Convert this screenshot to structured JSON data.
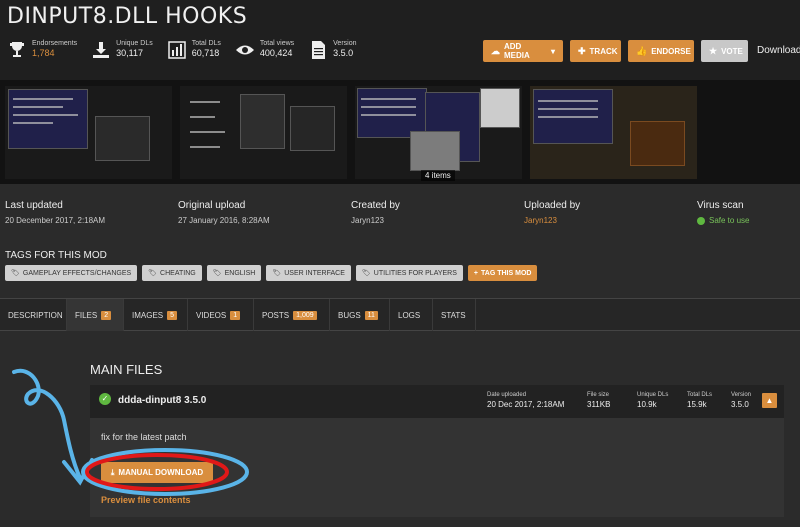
{
  "mod": {
    "title": "DINPUT8.DLL HOOKS"
  },
  "stats": [
    {
      "label": "Endorsements",
      "value": "1,784",
      "icon": "trophy-icon"
    },
    {
      "label": "Unique DLs",
      "value": "30,117",
      "icon": "download-icon"
    },
    {
      "label": "Total DLs",
      "value": "60,718",
      "icon": "bar-chart-icon"
    },
    {
      "label": "Total views",
      "value": "400,424",
      "icon": "eye-icon"
    },
    {
      "label": "Version",
      "value": "3.5.0",
      "icon": "document-icon"
    }
  ],
  "actions": {
    "add_media": "ADD MEDIA",
    "track": "TRACK",
    "endorse": "ENDORSE",
    "vote": "VOTE",
    "download": "Download:"
  },
  "gallery": {
    "count_label": "4 items"
  },
  "meta": {
    "last_updated": {
      "label": "Last updated",
      "value": "20 December 2017,  2:18AM"
    },
    "original_upload": {
      "label": "Original upload",
      "value": "27 January 2016,  8:28AM"
    },
    "created_by": {
      "label": "Created by",
      "value": "Jaryn123"
    },
    "uploaded_by": {
      "label": "Uploaded by",
      "value": "Jaryn123"
    },
    "virus_scan": {
      "label": "Virus scan",
      "value": "Safe to use"
    }
  },
  "tags": {
    "title": "TAGS FOR THIS MOD",
    "items": [
      "GAMEPLAY EFFECTS/CHANGES",
      "CHEATING",
      "ENGLISH",
      "USER INTERFACE",
      "UTILITIES FOR PLAYERS"
    ],
    "add_label": "TAG THIS MOD"
  },
  "tabs": [
    {
      "label": "DESCRIPTION",
      "count": ""
    },
    {
      "label": "FILES",
      "count": "2"
    },
    {
      "label": "IMAGES",
      "count": "5"
    },
    {
      "label": "VIDEOS",
      "count": "1"
    },
    {
      "label": "POSTS",
      "count": "1,009"
    },
    {
      "label": "BUGS",
      "count": "11"
    },
    {
      "label": "LOGS",
      "count": ""
    },
    {
      "label": "STATS",
      "count": ""
    }
  ],
  "files": {
    "section_title": "MAIN FILES",
    "file": {
      "name": "ddda-dinput8 3.5.0",
      "date_label": "Date uploaded",
      "date_value": "20 Dec 2017, 2:18AM",
      "size_label": "File size",
      "size_value": "311KB",
      "unique_label": "Unique DLs",
      "unique_value": "10.9k",
      "total_label": "Total DLs",
      "total_value": "15.9k",
      "version_label": "Version",
      "version_value": "3.5.0",
      "description": "fix for the latest patch",
      "manual_download": "MANUAL DOWNLOAD",
      "preview": "Preview file contents"
    }
  },
  "colors": {
    "accent": "#d98e3e",
    "annotation_blue": "#5ab4e8",
    "annotation_red": "#e01818",
    "safe_green": "#5fb840"
  }
}
